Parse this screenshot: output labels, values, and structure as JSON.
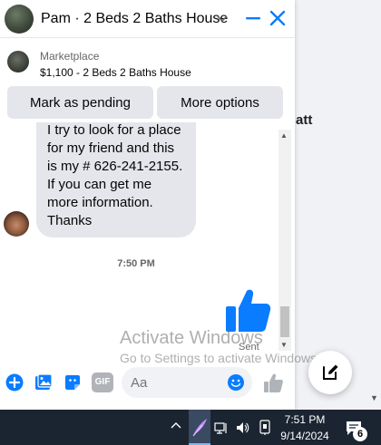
{
  "background_page": {
    "partial_text": "att"
  },
  "chat": {
    "header": {
      "title": "Pam · 2 Beds 2 Baths House"
    },
    "listing": {
      "source": "Marketplace",
      "title": "$1,100 - 2 Beds 2 Baths House",
      "buttons": {
        "mark_pending": "Mark as pending",
        "more_options": "More options"
      }
    },
    "messages": {
      "incoming_lines": [
        "I try to look for a place",
        "for my friend and this",
        "is my # 626-241-2155.",
        "If you can get me",
        "more information.",
        "Thanks"
      ],
      "timestamp": "7:50 PM",
      "sent_status": "Sent"
    },
    "composer": {
      "placeholder": "Aa",
      "gif_label": "GIF"
    }
  },
  "watermark": {
    "title": "Activate Windows",
    "subtitle": "Go to Settings to activate Windows."
  },
  "taskbar": {
    "time": "7:51 PM",
    "date": "9/14/2024",
    "notification_count": "6"
  },
  "colors": {
    "accent": "#0a7cff",
    "bubble_incoming": "#e4e6eb",
    "taskbar": "#1b2532"
  }
}
